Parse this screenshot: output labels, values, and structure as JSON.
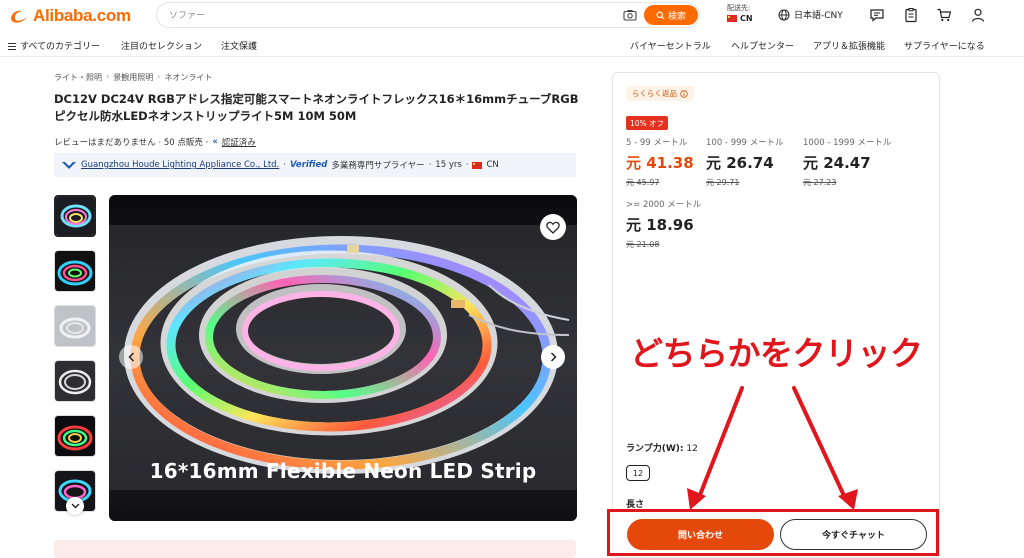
{
  "header": {
    "logo_text": "Alibaba.com",
    "search_placeholder": "ソファー",
    "search_button": "検索",
    "deliver_label": "配送先:",
    "deliver_country": "CN",
    "language_currency": "日本語-CNY",
    "accent_color": "#ff6a00",
    "icons": [
      "camera-icon",
      "search-icon",
      "globe-icon",
      "message-icon",
      "orders-icon",
      "cart-icon",
      "user-icon"
    ]
  },
  "subnav": {
    "left": [
      "すべてのカテゴリー",
      "注目のセレクション",
      "注文保護"
    ],
    "right": [
      "バイヤーセントラル",
      "ヘルプセンター",
      "アプリ＆拡張機能",
      "サプライヤーになる"
    ]
  },
  "product": {
    "breadcrumb": [
      "ライト・照明",
      "景観用照明",
      "ネオンライト"
    ],
    "title": "DC12V DC24V RGBアドレス指定可能スマートネオンライトフレックス16＊16mmチューブRGBピクセル防水LEDネオンストリップライト5M 10M 50M",
    "reviews": "レビューはまだありません · 50 点販売 ·",
    "verified": "認証済み",
    "supplier_name": "Guangzhou Houde Lighting Appliance Co., Ltd.",
    "supplier_badge": "Verified",
    "supplier_type": "多業務専門サプライヤー",
    "supplier_years": "15 yrs",
    "supplier_country": "CN",
    "image_caption": "16*16mm Flexible Neon LED Strip"
  },
  "pricing": {
    "easy_return": "らくらく返品",
    "discount_badge": "10% オフ",
    "tiers": [
      {
        "range": "5 - 99 メートル",
        "price": "元 41.38",
        "old": "元 45.97"
      },
      {
        "range": "100 - 999 メートル",
        "price": "元 26.74",
        "old": "元 29.71"
      },
      {
        "range": "1000 - 1999 メートル",
        "price": "元 24.47",
        "old": "元 27.23"
      },
      {
        "range": ">= 2000 メートル",
        "price": "元 18.96",
        "old": "元 21.08"
      }
    ],
    "attribute_label": "ランプ力(W):",
    "attribute_value": "12",
    "attribute_option": "12",
    "attribute2_label": "長さ",
    "inquiry_button": "問い合わせ",
    "chat_button": "今すぐチャット",
    "button_color": "#e5480b"
  },
  "annotation": {
    "text": "どちらかをクリック",
    "color": "#e0161d"
  }
}
